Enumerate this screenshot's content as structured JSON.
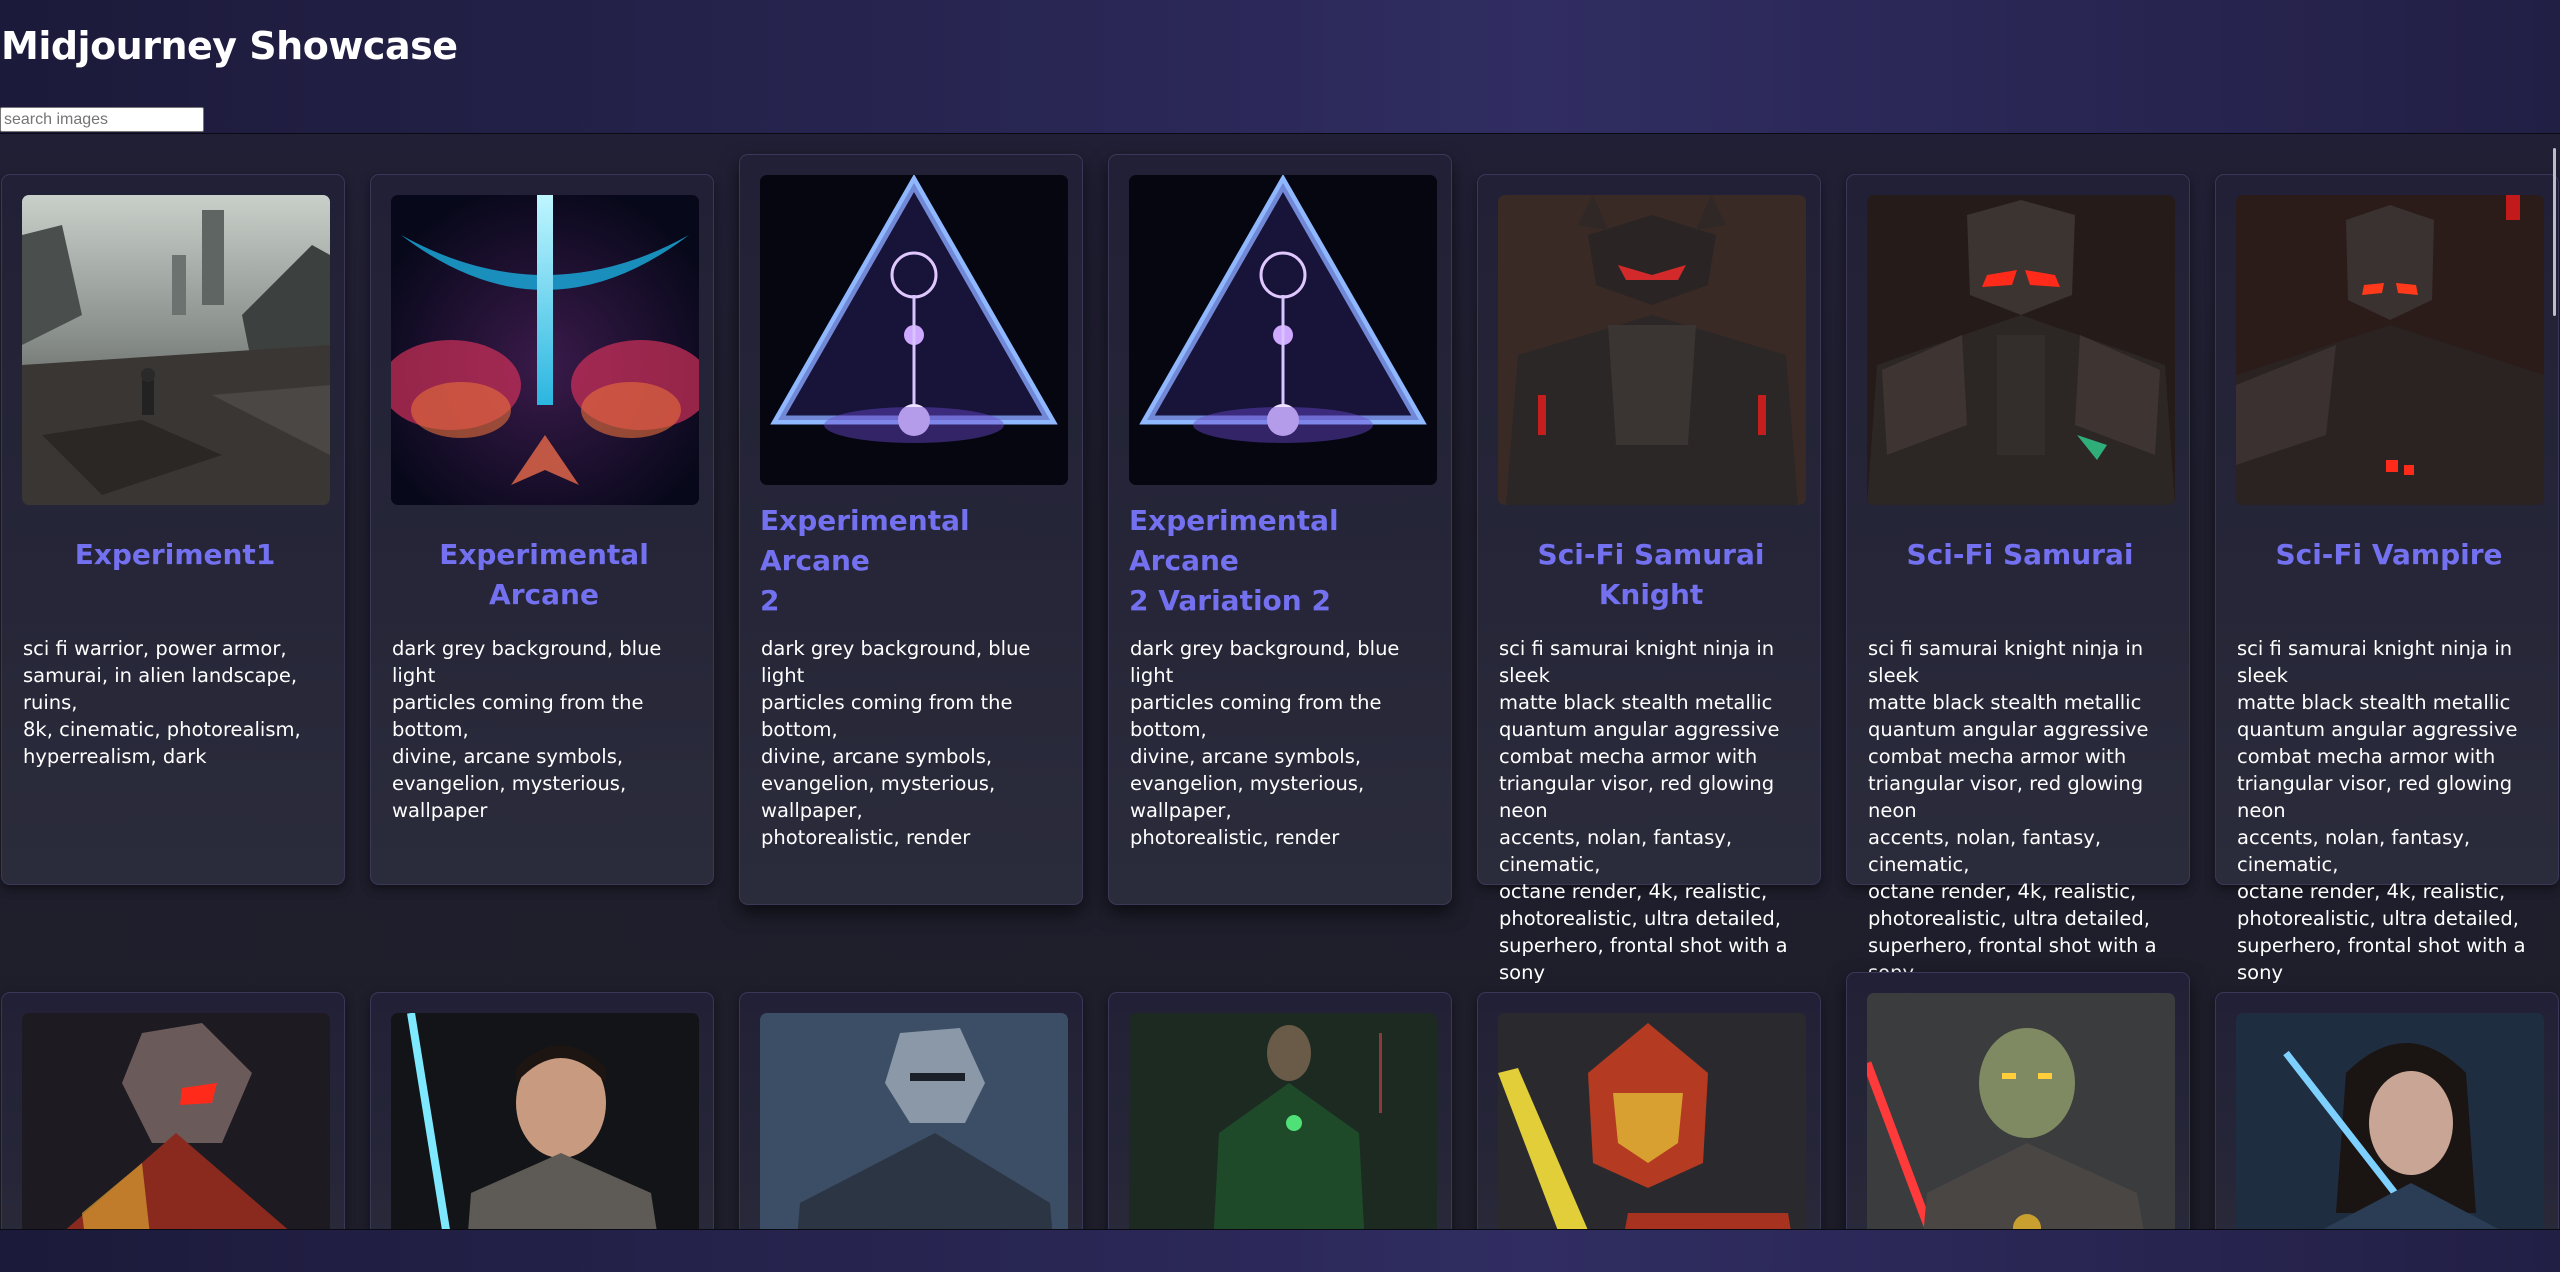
{
  "header": {
    "title": "Midjourney Showcase",
    "search": {
      "placeholder": "search images",
      "value": ""
    }
  },
  "cards": [
    {
      "title": "Experiment1",
      "description": "sci fi warrior, power armor,\nsamurai, in alien landscape, ruins,\n8k, cinematic, photorealism,\nhyperrealism, dark",
      "image": "sci-fi-warrior-ruins"
    },
    {
      "title": "Experimental Arcane",
      "description": "dark grey background, blue light\nparticles coming from the bottom,\ndivine, arcane symbols,\nevangelion, mysterious, wallpaper",
      "image": "arcane-blue-cross"
    },
    {
      "title": "Experimental Arcane\n2",
      "description": "dark grey background, blue light\nparticles coming from the bottom,\ndivine, arcane symbols,\nevangelion, mysterious, wallpaper,\nphotorealistic, render",
      "image": "arcane-triangle"
    },
    {
      "title": "Experimental Arcane\n2 Variation 2",
      "description": "dark grey background, blue light\nparticles coming from the bottom,\ndivine, arcane symbols,\nevangelion, mysterious, wallpaper,\nphotorealistic, render",
      "image": "arcane-triangle"
    },
    {
      "title": "Sci-Fi Samurai Knight",
      "description": "sci fi samurai knight ninja in sleek\nmatte black stealth metallic\nquantum angular aggressive\ncombat mecha armor with\ntriangular visor, red glowing neon\naccents, nolan, fantasy, cinematic,\noctane render, 4k, realistic,\nphotorealistic, ultra detailed,\nsuperhero, frontal shot with a sony",
      "image": "samurai-knight"
    },
    {
      "title": "Sci-Fi Samurai",
      "description": "sci fi samurai knight ninja in sleek\nmatte black stealth metallic\nquantum angular aggressive\ncombat mecha armor with\ntriangular visor, red glowing neon\naccents, nolan, fantasy, cinematic,\noctane render, 4k, realistic,\nphotorealistic, ultra detailed,\nsuperhero, frontal shot with a sony",
      "image": "samurai-mecha"
    },
    {
      "title": "Sci-Fi Vampire",
      "description": "sci fi samurai knight ninja in sleek\nmatte black stealth metallic\nquantum angular aggressive\ncombat mecha armor with\ntriangular visor, red glowing neon\naccents, nolan, fantasy, cinematic,\noctane render, 4k, realistic,\nphotorealistic, ultra detailed,\nsuperhero, frontal shot with a sony",
      "image": "vampire-mecha"
    }
  ],
  "second_row_images": [
    "red-armored-knight",
    "jedi-blue-saber",
    "dark-knight-armor",
    "green-lantern-cloak",
    "gold-hooded-warrior",
    "sith-red-saber",
    "woman-blue-saber"
  ],
  "colors": {
    "title_accent": "#7371f0",
    "header_bg": "#2a2756",
    "page_bg": "#1e1d2c"
  }
}
